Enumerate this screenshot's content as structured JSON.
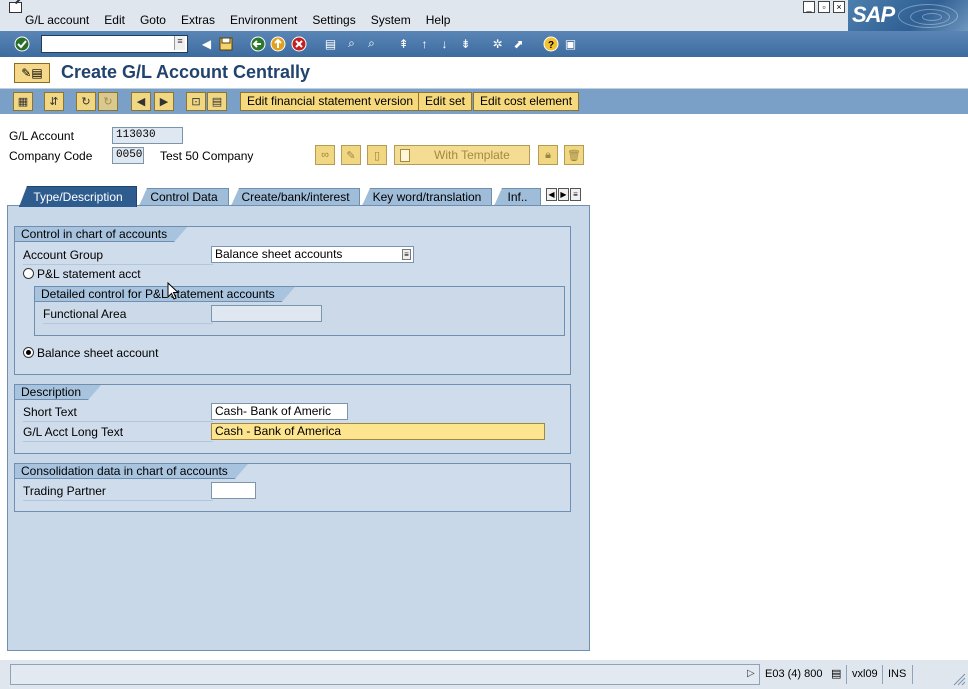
{
  "menu": {
    "items": [
      "G/L account",
      "Edit",
      "Goto",
      "Extras",
      "Environment",
      "Settings",
      "System",
      "Help"
    ]
  },
  "brand": {
    "logo_text": "SAP",
    "accent": "#21436d"
  },
  "standard_toolbar": {
    "command_field_value": "",
    "icons": [
      "enter-icon",
      "save-icon",
      "back-icon",
      "exit-icon",
      "cancel-icon",
      "print-icon",
      "find-icon",
      "find-next-icon",
      "first-page-icon",
      "previous-page-icon",
      "next-page-icon",
      "last-page-icon",
      "create-session-icon",
      "create-shortcut-icon",
      "help-icon",
      "layout-menu-icon"
    ]
  },
  "title": {
    "text": "Create G/L Account Centrally"
  },
  "app_toolbar": {
    "buttons": {
      "edit_fsv": "Edit financial statement version",
      "edit_set": "Edit set",
      "edit_cost_element": "Edit cost element"
    }
  },
  "header": {
    "gl_account_label": "G/L Account",
    "gl_account_value": "113030",
    "company_code_label": "Company Code",
    "company_code_value": "0050",
    "company_name": "Test 50 Company",
    "with_template_label": "With Template"
  },
  "tabs": [
    {
      "label": "Type/Description",
      "active": true
    },
    {
      "label": "Control Data",
      "active": false
    },
    {
      "label": "Create/bank/interest",
      "active": false
    },
    {
      "label": "Key word/translation",
      "active": false
    },
    {
      "label": "Inf..",
      "active": false
    }
  ],
  "control_group": {
    "title": "Control in chart of accounts",
    "account_group_label": "Account Group",
    "account_group_value": "Balance sheet accounts",
    "pl_radio_label": "P&L statement acct",
    "pl_selected": false,
    "detail_title": "Detailed control for P&L statement accounts",
    "functional_area_label": "Functional Area",
    "functional_area_value": "",
    "bs_radio_label": "Balance sheet account",
    "bs_selected": true
  },
  "description_group": {
    "title": "Description",
    "short_text_label": "Short Text",
    "short_text_value": "Cash- Bank of Americ",
    "long_text_label": "G/L Acct Long Text",
    "long_text_value": "Cash - Bank of America"
  },
  "consolidation_group": {
    "title": "Consolidation data in chart of accounts",
    "trading_partner_label": "Trading Partner",
    "trading_partner_value": ""
  },
  "status": {
    "message": "",
    "system": "E03 (4) 800",
    "server": "vxl09",
    "mode": "INS"
  }
}
